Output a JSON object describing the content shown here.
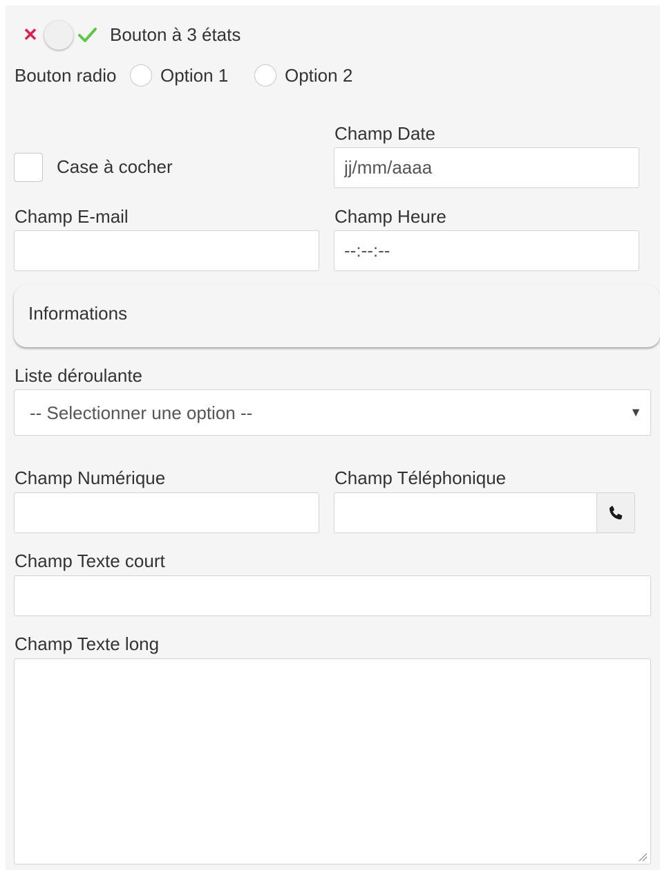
{
  "tristate": {
    "label": "Bouton à 3 états",
    "state": "neutral"
  },
  "radio": {
    "label": "Bouton radio",
    "options": [
      {
        "label": "Option 1",
        "checked": false
      },
      {
        "label": "Option 2",
        "checked": false
      }
    ]
  },
  "checkbox": {
    "label": "Case à cocher",
    "checked": false
  },
  "date": {
    "label": "Champ Date",
    "placeholder": "jj/mm/aaaa"
  },
  "email": {
    "label": "Champ E-mail",
    "value": ""
  },
  "time": {
    "label": "Champ Heure",
    "placeholder": "--:--:--"
  },
  "info": {
    "label": "Informations"
  },
  "dropdown": {
    "label": "Liste déroulante",
    "selected": "-- Selectionner une option --"
  },
  "number": {
    "label": "Champ Numérique",
    "value": ""
  },
  "phone": {
    "label": "Champ Téléphonique",
    "value": "",
    "icon": "phone-icon"
  },
  "short_text": {
    "label": "Champ Texte court",
    "value": ""
  },
  "long_text": {
    "label": "Champ Texte long",
    "value": ""
  },
  "colors": {
    "panel_bg": "#f5f5f5",
    "toggle_off": "#e8174c",
    "toggle_on": "#5cc943",
    "text": "#333333",
    "border": "#d3d3d3"
  }
}
